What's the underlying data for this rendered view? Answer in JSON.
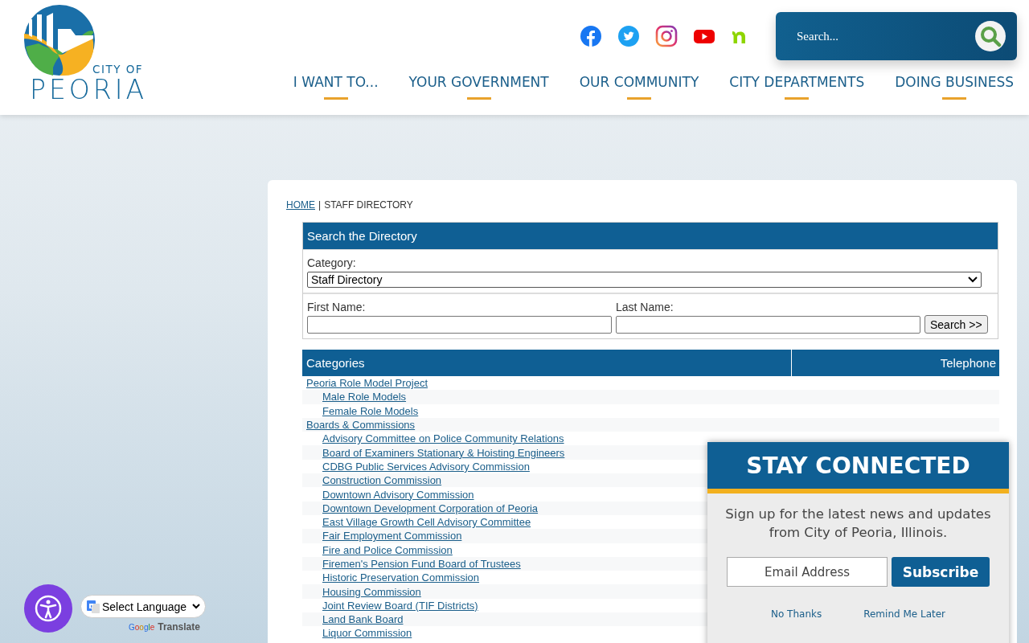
{
  "logo": {
    "small": "CITY OF",
    "large": "PEORIA"
  },
  "social": [
    {
      "kind": "facebook"
    },
    {
      "kind": "twitter"
    },
    {
      "kind": "instagram"
    },
    {
      "kind": "youtube"
    },
    {
      "kind": "nextdoor"
    }
  ],
  "search": {
    "placeholder": "Search..."
  },
  "nav": [
    "I WANT TO...",
    "YOUR GOVERNMENT",
    "OUR COMMUNITY",
    "CITY DEPARTMENTS",
    "DOING BUSINESS"
  ],
  "breadcrumb": {
    "link": "HOME",
    "separator": "|",
    "current": "STAFF DIRECTORY"
  },
  "directory_search": {
    "title": "Search the Directory",
    "category_label": "Category:",
    "category_value": "Staff Directory",
    "first_name_label": "First Name:",
    "last_name_label": "Last Name:",
    "button": "Search >>"
  },
  "table": {
    "columns": [
      "Categories",
      "Telephone"
    ],
    "rows": [
      {
        "label": "Peoria Role Model Project",
        "children": [
          {
            "label": "Male Role Models"
          },
          {
            "label": "Female Role Models"
          }
        ]
      },
      {
        "label": "Boards & Commissions",
        "children": [
          {
            "label": "Advisory Committee on Police Community Relations"
          },
          {
            "label": "Board of Examiners Stationary & Hoisting Engineers"
          },
          {
            "label": "CDBG Public Services Advisory Commission"
          },
          {
            "label": "Construction Commission"
          },
          {
            "label": "Downtown Advisory Commission"
          },
          {
            "label": "Downtown Development Corporation of Peoria"
          },
          {
            "label": "East Village Growth Cell Advisory Committee"
          },
          {
            "label": "Fair Employment Commission"
          },
          {
            "label": "Fire and Police Commission"
          },
          {
            "label": "Firemen's Pension Fund Board of Trustees"
          },
          {
            "label": "Historic Preservation Commission"
          },
          {
            "label": "Housing Commission"
          },
          {
            "label": "Joint Review Board (TIF Districts)"
          },
          {
            "label": "Land Bank Board"
          },
          {
            "label": "Liquor Commission"
          }
        ]
      }
    ]
  },
  "popup": {
    "title": "STAY CONNECTED",
    "text": "Sign up for the latest news and updates from City of Peoria, Illinois.",
    "email_placeholder": "Email Address",
    "subscribe": "Subscribe",
    "no_thanks": "No Thanks",
    "remind": "Remind Me Later"
  },
  "translate": {
    "select": "Select Language",
    "brand": "Google",
    "label": "Translate"
  }
}
